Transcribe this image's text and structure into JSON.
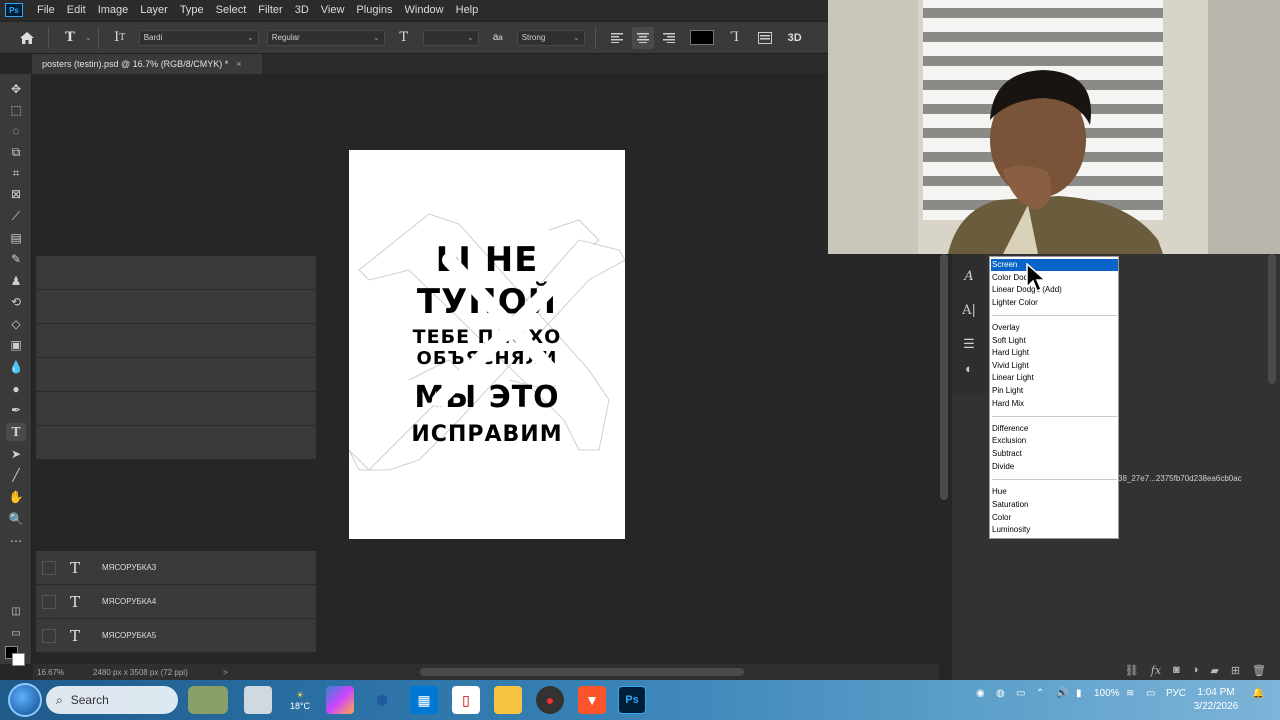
{
  "menu": [
    "File",
    "Edit",
    "Image",
    "Layer",
    "Type",
    "Select",
    "Filter",
    "3D",
    "View",
    "Plugins",
    "Window",
    "Help"
  ],
  "options_bar": {
    "font_family": "Bardi",
    "font_style": "Regular",
    "font_size": "",
    "antialias": "Strong",
    "three_d": "3D"
  },
  "document_tab": {
    "title": "posters (testin).psd @ 16.7% (RGB/8/CMYK) *",
    "close": "×"
  },
  "poster": {
    "lines": [
      "Ы НЕ",
      "ТУПОЙ",
      "ТЕБЕ ПЛОХО",
      "ОБЪЯСНЯЛИ",
      "МЫ ЭТО",
      "ИСПРАВИМ"
    ]
  },
  "status_bar": {
    "zoom": "16.67%",
    "dimensions": "2480 px x 3508 px (72 ppi)",
    "arrow": ">"
  },
  "blend_modes": {
    "group1": [
      "Screen",
      "Color Dodge",
      "Linear Dodge (Add)",
      "Lighter Color"
    ],
    "group2": [
      "Overlay",
      "Soft Light",
      "Hard Light",
      "Vivid Light",
      "Linear Light",
      "Pin Light",
      "Hard Mix"
    ],
    "group3": [
      "Difference",
      "Exclusion",
      "Subtract",
      "Divide"
    ],
    "group4": [
      "Hue",
      "Saturation",
      "Color",
      "Luminosity"
    ],
    "selected": "Screen"
  },
  "layers": {
    "hash_partial": "38_27e7...2375fb70d238ea6cb0ac",
    "items": [
      "МЯСОРУБКА3",
      "МЯСОРУБКА4",
      "МЯСОРУБКА5"
    ]
  },
  "taskbar": {
    "search": "Search",
    "weather": "18°C",
    "battery": "100%",
    "language": "РУС",
    "time": "1:04 PM",
    "date": "3/22/2026"
  },
  "colors": {
    "selection_blue": "#0a64c8",
    "ps_blue": "#31a8ff"
  }
}
